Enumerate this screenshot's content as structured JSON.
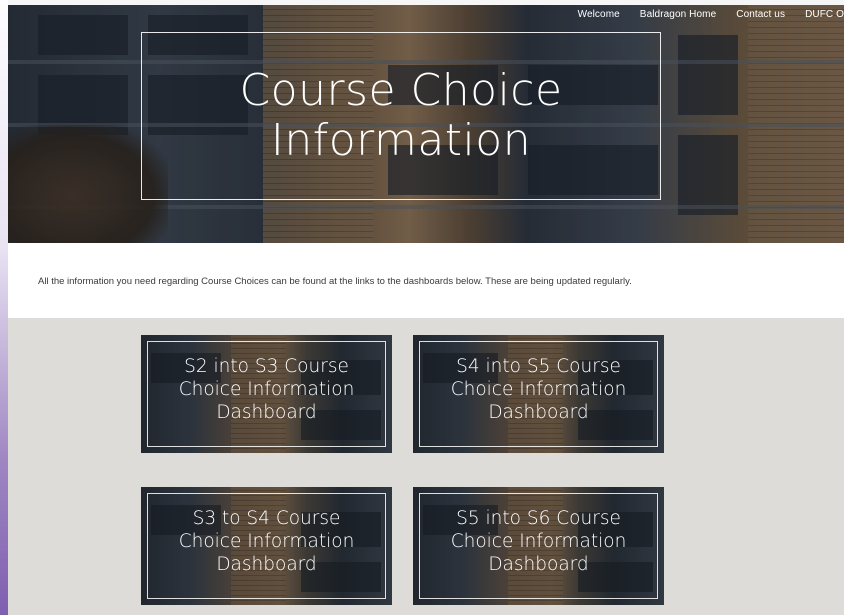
{
  "nav": {
    "links": [
      "Welcome",
      "Baldragon Home",
      "Contact us",
      "DUFC O"
    ]
  },
  "hero": {
    "title_line1": "Course Choice",
    "title_line2": "Information"
  },
  "intro": {
    "text": "All the information you need regarding Course Choices can be found at the links to the dashboards below. These are being updated regularly."
  },
  "dashboards": [
    {
      "line1": "S2 into S3 Course",
      "line2": "Choice Information",
      "line3": "Dashboard"
    },
    {
      "line1": "S4 into S5 Course",
      "line2": "Choice Information",
      "line3": "Dashboard"
    },
    {
      "line1": "S3 to S4 Course",
      "line2": "Choice Information",
      "line3": "Dashboard"
    },
    {
      "line1": "S5 into S6 Course",
      "line2": "Choice Information",
      "line3": "Dashboard"
    }
  ],
  "colors": {
    "page_background": "#dedcd8",
    "intro_background": "#ffffff",
    "text_white": "#ffffff",
    "intro_text": "#3a3a3a"
  }
}
